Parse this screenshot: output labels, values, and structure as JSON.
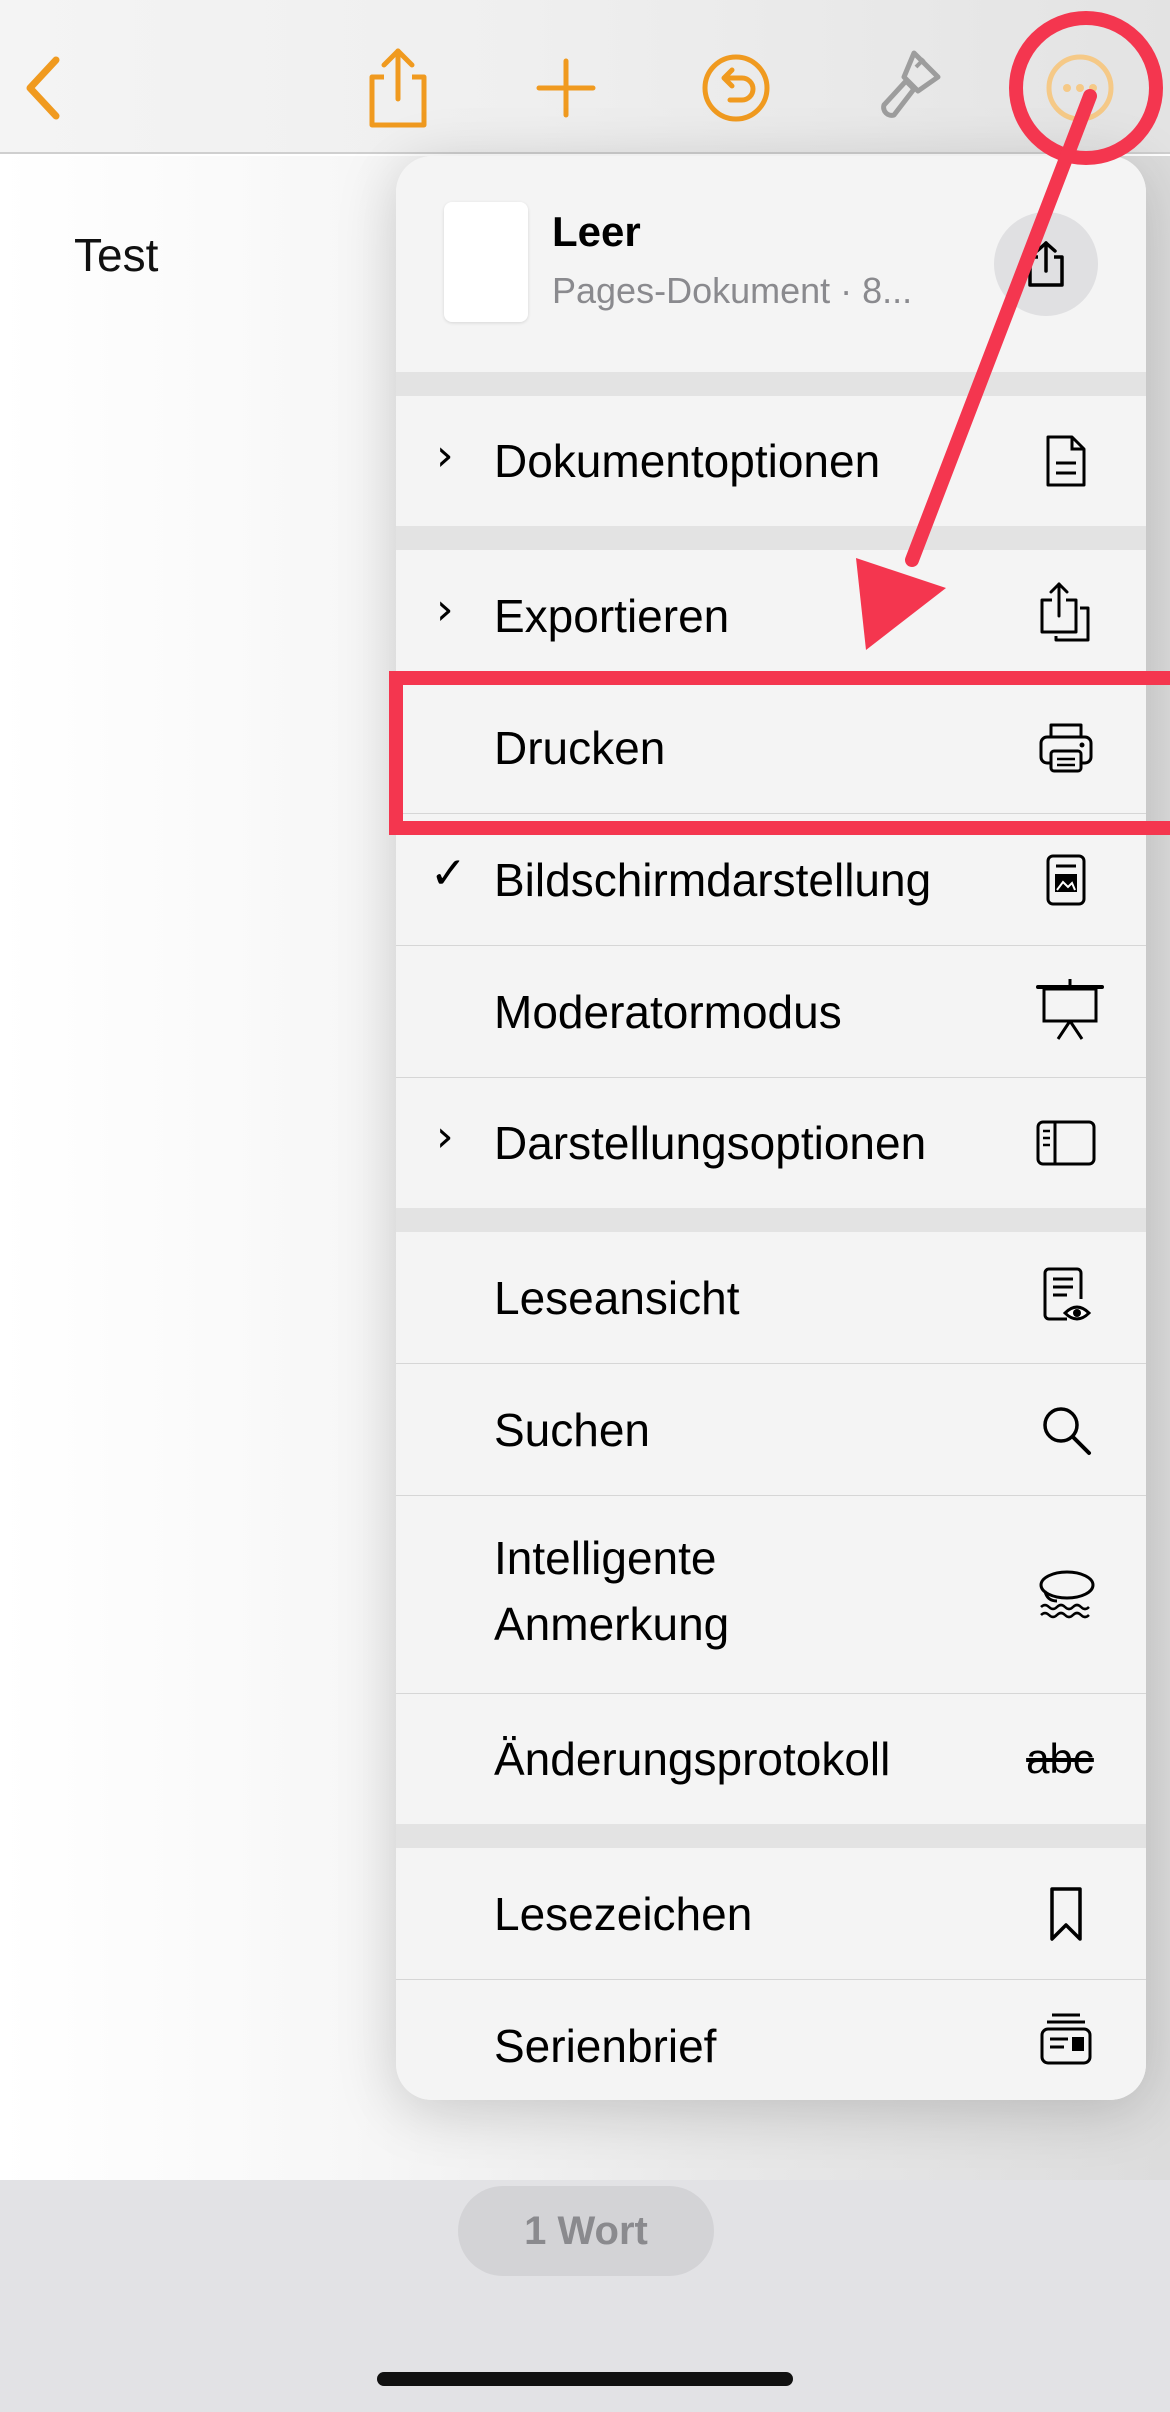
{
  "toolbar": {
    "accent_color": "#f09a1f",
    "buttons": [
      {
        "name": "back",
        "icon": "chevron-left-icon"
      },
      {
        "name": "share",
        "icon": "share-icon"
      },
      {
        "name": "add",
        "icon": "plus-icon"
      },
      {
        "name": "undo",
        "icon": "undo-icon"
      },
      {
        "name": "format",
        "icon": "paintbrush-icon"
      },
      {
        "name": "more",
        "icon": "ellipsis-circle-icon"
      }
    ]
  },
  "document": {
    "text": "Test"
  },
  "menu": {
    "header": {
      "title": "Leer",
      "subtitle": "Pages-Dokument · 8..."
    },
    "items": [
      {
        "label": "Dokumentoptionen",
        "submenu": true,
        "icon": "document-icon"
      },
      {
        "label": "Exportieren",
        "submenu": true,
        "icon": "export-icon"
      },
      {
        "label": "Drucken",
        "icon": "printer-icon",
        "highlighted": true
      },
      {
        "label": "Bildschirmdarstellung",
        "checked": true,
        "icon": "screen-view-icon"
      },
      {
        "label": "Moderatormodus",
        "icon": "presenter-icon"
      },
      {
        "label": "Darstellungsoptionen",
        "submenu": true,
        "icon": "sidebar-icon"
      },
      {
        "label": "Leseansicht",
        "icon": "reading-view-icon"
      },
      {
        "label": "Suchen",
        "icon": "magnifier-icon"
      },
      {
        "label_line1": "Intelligente",
        "label_line2": "Anmerkung",
        "icon": "smart-annotation-icon"
      },
      {
        "label": "Änderungsprotokoll",
        "icon": "strikethrough-abc-icon",
        "icon_text": "abc"
      },
      {
        "label": "Lesezeichen",
        "icon": "bookmark-icon"
      },
      {
        "label": "Serienbrief",
        "icon": "mail-merge-icon"
      }
    ]
  },
  "status": {
    "word_count": "1 Wort"
  },
  "annotation": {
    "color": "#f4364f"
  }
}
